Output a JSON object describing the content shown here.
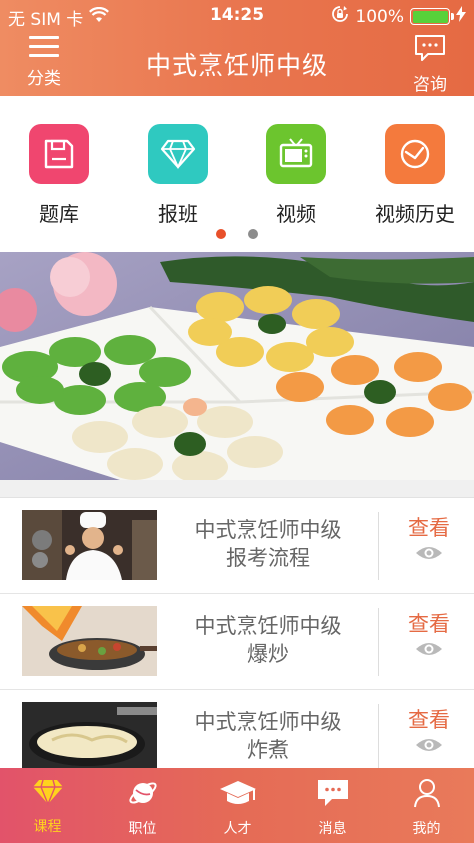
{
  "status_bar": {
    "carrier": "无 SIM 卡",
    "time": "14:25",
    "battery": "100%",
    "battery_fill": 1.0,
    "icons": [
      "wifi-icon",
      "rotation-lock-icon",
      "charging-bolt-icon"
    ]
  },
  "header": {
    "left_label": "分类",
    "title": "中式烹饪师中级",
    "right_label": "咨询",
    "left_icon": "menu-icon",
    "right_icon": "chat-icon"
  },
  "quick_nav": {
    "items": [
      {
        "label": "题库",
        "icon": "floppy-disk-icon",
        "color": "#f0466f"
      },
      {
        "label": "报班",
        "icon": "diamond-icon",
        "color": "#2fc9c0"
      },
      {
        "label": "视频",
        "icon": "tv-icon",
        "color": "#6cc52e"
      },
      {
        "label": "视频历史",
        "icon": "clock-icon",
        "color": "#f47a3d"
      }
    ],
    "page_count": 2,
    "active_page": 1
  },
  "banner": {
    "alt": "dumplings-banner"
  },
  "courses": [
    {
      "title_line1": "中式烹饪师中级",
      "title_line2": "报考流程",
      "view_label": "查看",
      "thumb": "chef-thumbnail"
    },
    {
      "title_line1": "中式烹饪师中级",
      "title_line2": "爆炒",
      "view_label": "查看",
      "thumb": "wok-fire-thumbnail"
    },
    {
      "title_line1": "中式烹饪师中级",
      "title_line2": "炸煮",
      "view_label": "查看",
      "thumb": "fried-food-thumbnail"
    }
  ],
  "tabbar": {
    "items": [
      {
        "label": "课程",
        "icon": "diamond-icon",
        "active": true
      },
      {
        "label": "职位",
        "icon": "planet-icon",
        "active": false
      },
      {
        "label": "人才",
        "icon": "graduation-cap-icon",
        "active": false
      },
      {
        "label": "消息",
        "icon": "message-icon",
        "active": false
      },
      {
        "label": "我的",
        "icon": "person-icon",
        "active": false
      }
    ]
  },
  "colors": {
    "header_gradient_start": "#ef8c62",
    "header_gradient_end": "#e56a43",
    "accent": "#e56a43",
    "tab_active": "#ffd21e",
    "dot_active": "#e8502a",
    "dot_inactive": "#8c8c8c"
  }
}
